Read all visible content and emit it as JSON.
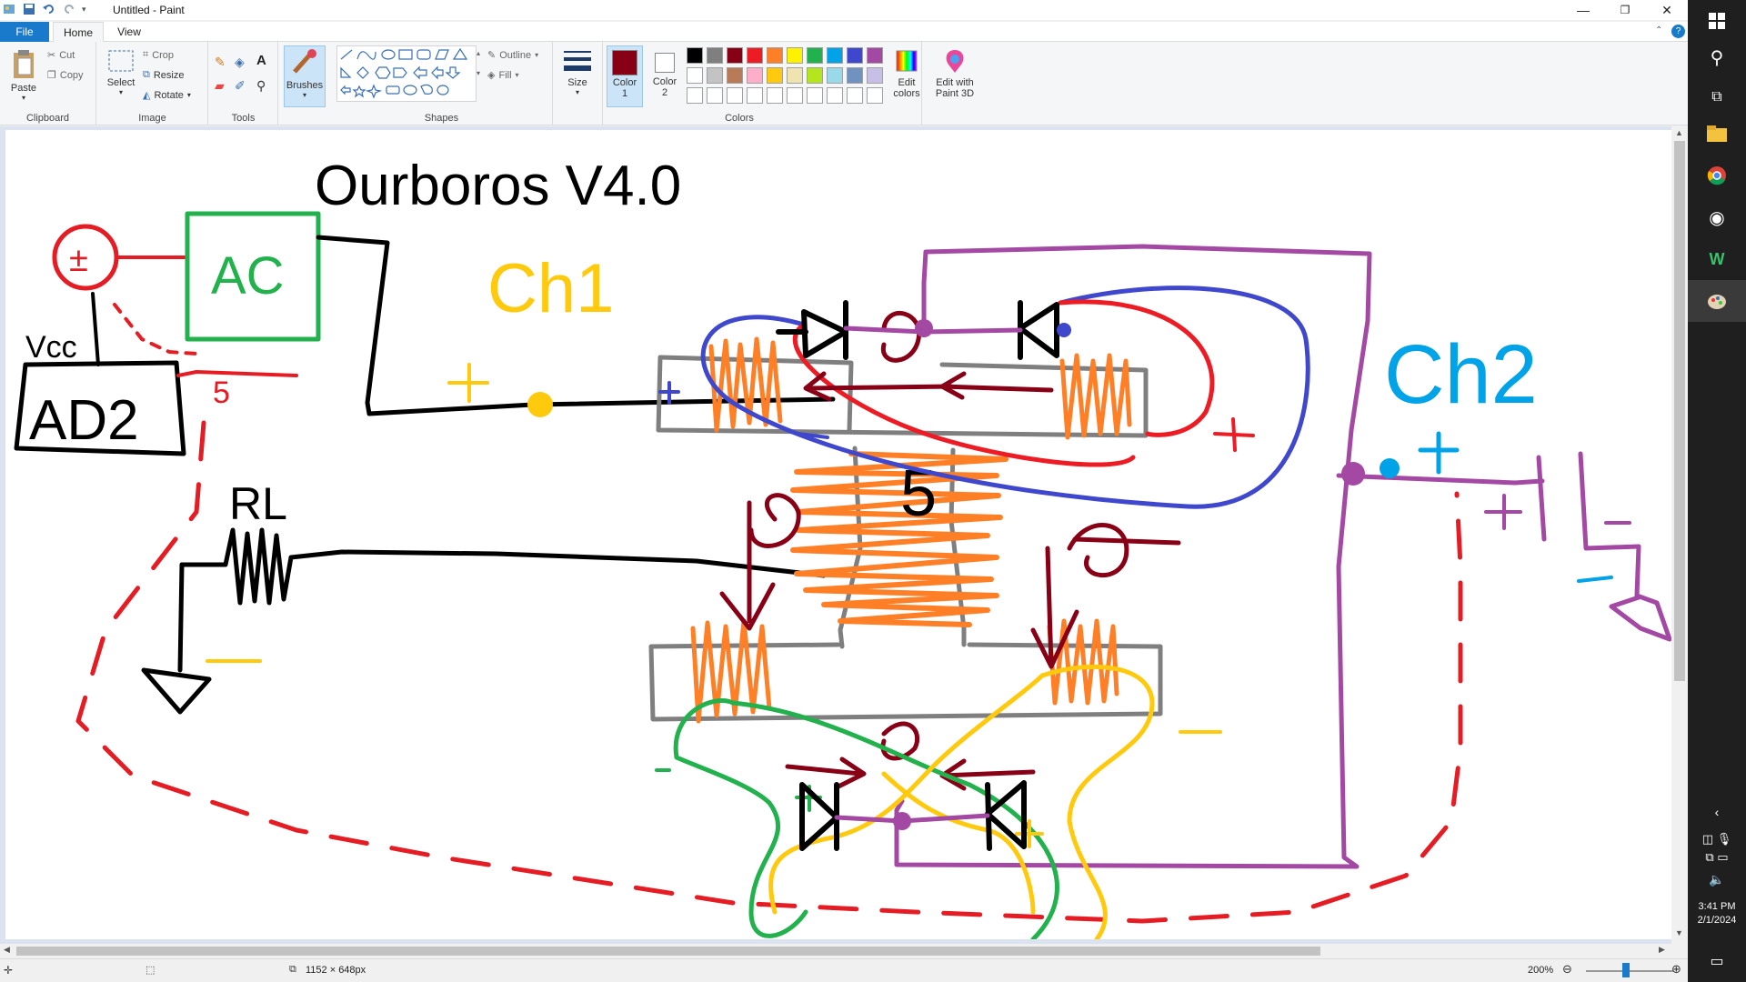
{
  "app": {
    "title": "Untitled - Paint"
  },
  "tabs": [
    {
      "label": "File"
    },
    {
      "label": "Home"
    },
    {
      "label": "View"
    }
  ],
  "ribbon": {
    "clipboard": {
      "group_label": "Clipboard",
      "paste": "Paste",
      "cut": "Cut",
      "copy": "Copy"
    },
    "image": {
      "group_label": "Image",
      "select": "Select",
      "crop": "Crop",
      "resize": "Resize",
      "rotate": "Rotate"
    },
    "tools": {
      "group_label": "Tools"
    },
    "brushes": {
      "label": "Brushes"
    },
    "shapes": {
      "group_label": "Shapes",
      "outline": "Outline",
      "fill": "Fill"
    },
    "size": {
      "label": "Size"
    },
    "colors": {
      "group_label": "Colors",
      "color1": "Color 1",
      "color2": "Color 2",
      "edit_colors": "Edit colors",
      "edit_paint3d": "Edit with Paint 3D",
      "color1_value": "#880015",
      "color2_value": "#ffffff",
      "palette_row1": [
        "#000000",
        "#7f7f7f",
        "#880015",
        "#ed1c24",
        "#ff7f27",
        "#fff200",
        "#22b14c",
        "#00a2e8",
        "#3f48cc",
        "#a349a4"
      ],
      "palette_row2": [
        "#ffffff",
        "#c3c3c3",
        "#b97a57",
        "#ffaec9",
        "#ffc90e",
        "#efe4b0",
        "#b5e61d",
        "#99d9ea",
        "#7092be",
        "#c8bfe7"
      ],
      "palette_row3": [
        "#ffffff",
        "#ffffff",
        "#ffffff",
        "#ffffff",
        "#ffffff",
        "#ffffff",
        "#ffffff",
        "#ffffff",
        "#ffffff",
        "#ffffff"
      ]
    }
  },
  "drawing": {
    "title_text": "Ourboros V4.0",
    "ac_label": "AC",
    "ad2_label": "AD2",
    "vcc_label": "Vcc",
    "rl_label": "RL",
    "ch1_label": "Ch1",
    "ch2_label": "Ch2",
    "core_label": "5",
    "voltage_label": "5",
    "pm_label": "±"
  },
  "status": {
    "dimensions": "1152 × 648px",
    "zoom": "200%"
  },
  "taskbar": {
    "time": "3:41 PM",
    "date": "2/1/2024"
  }
}
